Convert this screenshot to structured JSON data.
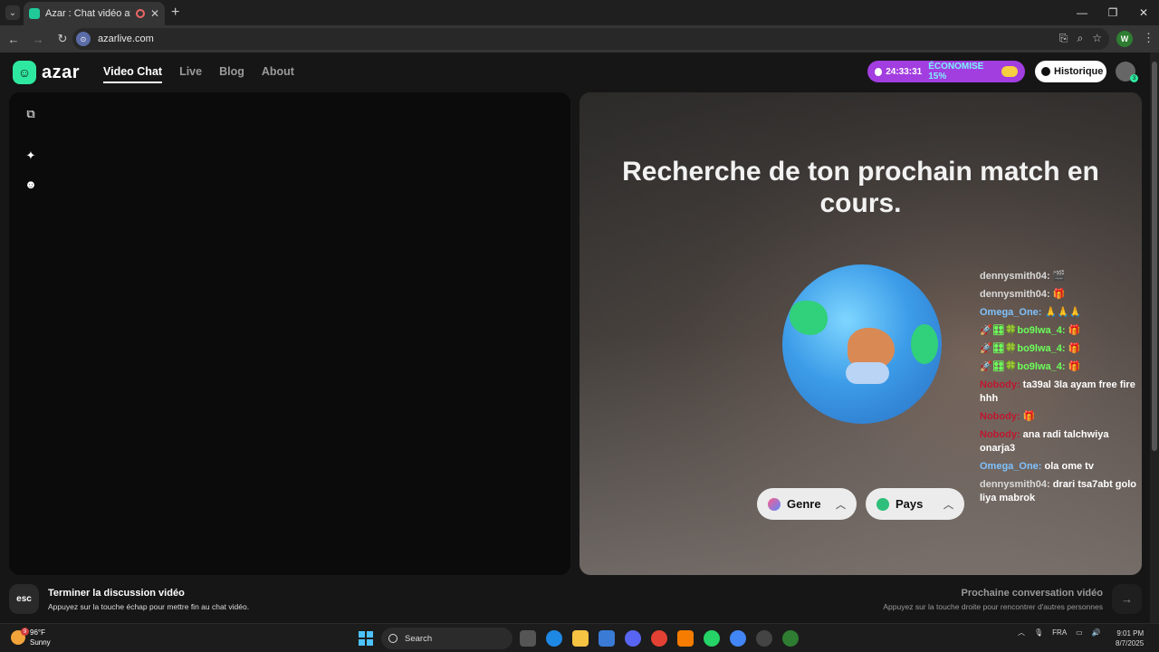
{
  "browser": {
    "tab_title": "Azar : Chat vidéo avec de n",
    "url": "azarlive.com",
    "profile_initial": "W"
  },
  "header": {
    "logo_text": "azar",
    "nav": [
      "Video Chat",
      "Live",
      "Blog",
      "About"
    ],
    "promo_timer": "24:33:31",
    "promo_text": "ÉCONOMISE 15%",
    "history_label": "Historique",
    "avatar_badge": "3"
  },
  "match": {
    "headline": "Recherche de ton prochain match en cours.",
    "gender_label": "Genre",
    "country_label": "Pays"
  },
  "chat": {
    "messages": [
      {
        "user": "dennysmith04:",
        "text": "🎬"
      },
      {
        "user": "dennysmith04:",
        "text": "🎁"
      },
      {
        "user": "Omega_One:",
        "text": "🙏🙏🙏"
      },
      {
        "user": "🚀🎛🍀bo9lwa_4:",
        "text": "🎁"
      },
      {
        "user": "🚀🎛🍀bo9lwa_4:",
        "text": "🎁"
      },
      {
        "user": "🚀🎛🍀bo9lwa_4:",
        "text": "🎁"
      },
      {
        "user": "Nobody:",
        "text": "ta39al 3la ayam free fire hhh"
      },
      {
        "user": "Nobody:",
        "text": "🎁"
      },
      {
        "user": "Nobody:",
        "text": "ana radi talchwiya onarja3"
      },
      {
        "user": "Omega_One:",
        "text": "ola ome tv"
      },
      {
        "user": "dennysmith04:",
        "text": "drari tsa7abt golo liya mabrok"
      }
    ]
  },
  "footer": {
    "esc_key": "esc",
    "end_title": "Terminer la discussion vidéo",
    "end_sub": "Appuyez sur la touche échap pour mettre fin au chat vidéo.",
    "next_title": "Prochaine conversation vidéo",
    "next_sub": "Appuyez sur la touche droite pour rencontrer d'autres personnes"
  },
  "taskbar": {
    "weather_temp": "96°F",
    "weather_desc": "Sunny",
    "weather_badge": "9",
    "search_label": "Search",
    "lang": "FRA",
    "time": "9:01 PM",
    "date": "8/7/2025"
  }
}
